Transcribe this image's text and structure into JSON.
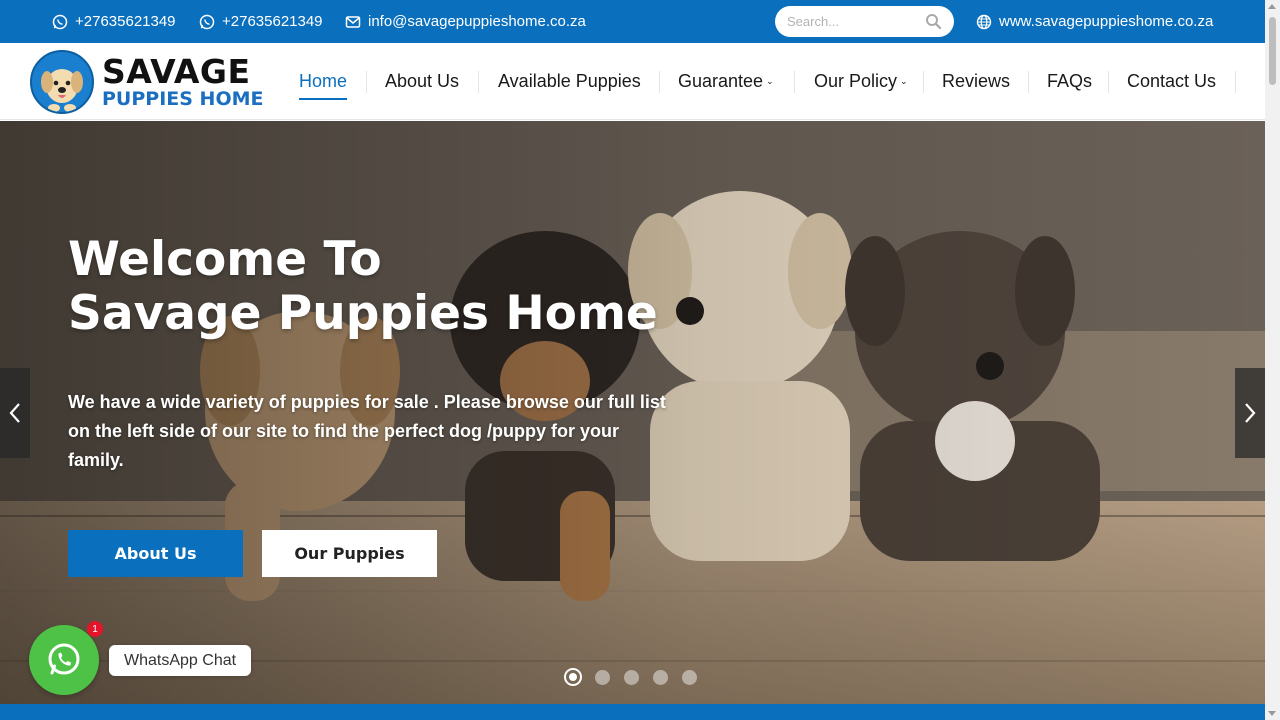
{
  "topbar": {
    "phone1": "+27635621349",
    "phone2": "+27635621349",
    "email": "info@savagepuppieshome.co.za",
    "search_placeholder": "Search...",
    "website": "www.savagepuppieshome.co.za"
  },
  "logo": {
    "line1": "SAVAGE",
    "line2": "PUPPIES HOME"
  },
  "nav": {
    "items": [
      {
        "label": "Home"
      },
      {
        "label": "About Us"
      },
      {
        "label": "Available Puppies"
      },
      {
        "label": "Guarantee",
        "caret": "⌄"
      },
      {
        "label": "Our Policy",
        "caret": "⌄"
      },
      {
        "label": "Reviews"
      },
      {
        "label": "FAQs"
      },
      {
        "label": "Contact Us"
      }
    ]
  },
  "hero": {
    "title_line1": "Welcome To",
    "title_line2": "Savage Puppies Home",
    "subtitle": "We have a wide variety of puppies for sale . Please browse our full list on the left side of our site to find the perfect dog /puppy for your family.",
    "btn_primary": "About Us",
    "btn_secondary": "Our Puppies",
    "slide_count": 5,
    "active_slide": 1
  },
  "whatsapp": {
    "label": "WhatsApp Chat",
    "badge": "1"
  },
  "colors": {
    "brand_blue": "#0a6fbd",
    "whatsapp_green": "#4dc247",
    "badge_red": "#e4152a"
  }
}
